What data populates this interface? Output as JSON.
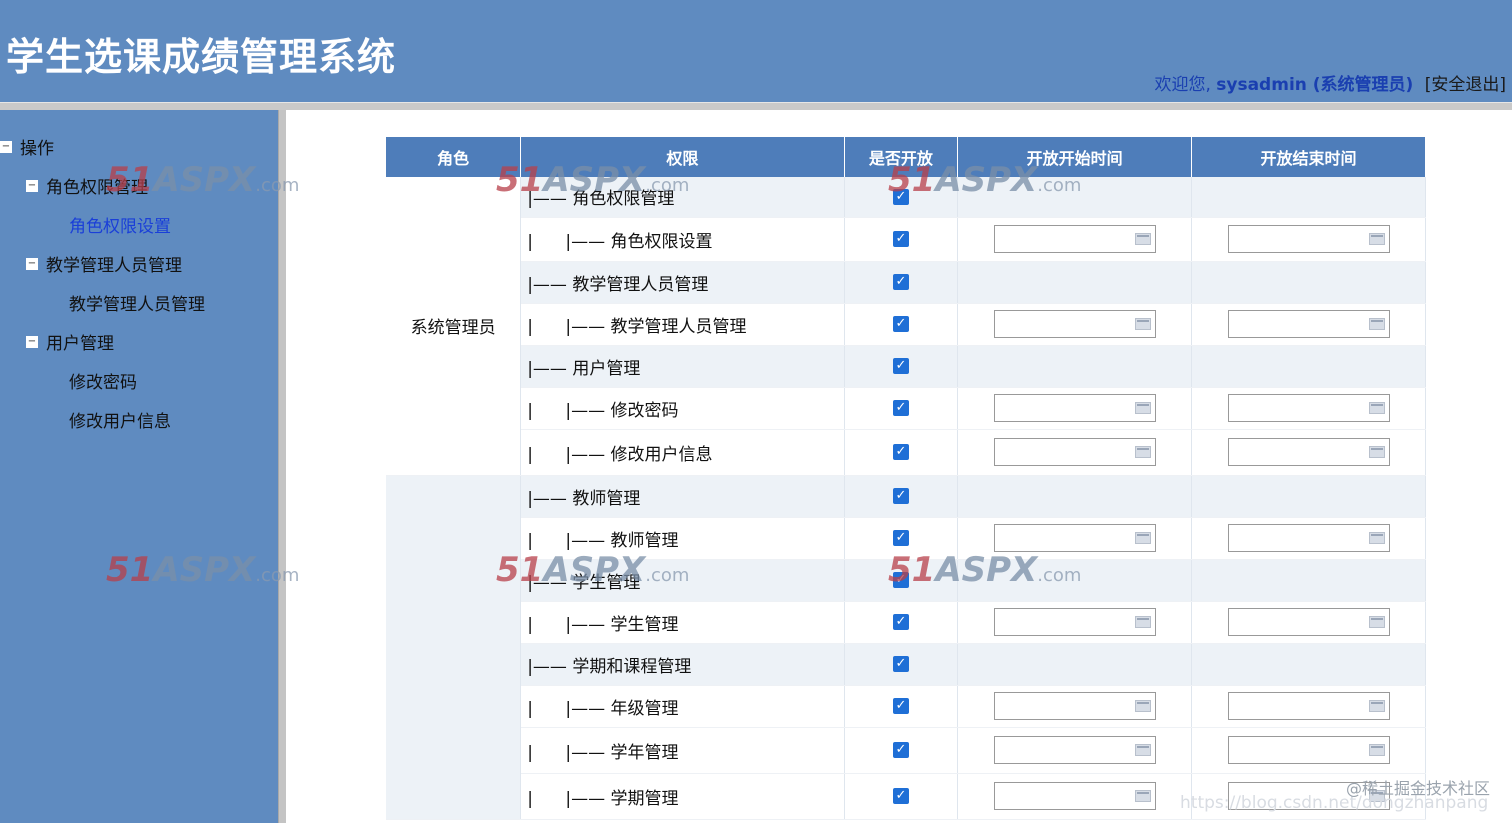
{
  "header": {
    "title": "学生选课成绩管理系统",
    "welcome": "欢迎您,",
    "username": "sysadmin (系统管理员)",
    "logout": "[安全退出]"
  },
  "sidebar": {
    "root": "操作",
    "groups": [
      {
        "label": "角色权限管理",
        "items": [
          "角色权限设置"
        ]
      },
      {
        "label": "教学管理人员管理",
        "items": [
          "教学管理人员管理"
        ]
      },
      {
        "label": "用户管理",
        "items": [
          "修改密码",
          "修改用户信息"
        ]
      }
    ]
  },
  "table": {
    "headers": [
      "角色",
      "权限",
      "是否开放",
      "开放开始时间",
      "开放结束时间"
    ],
    "role_label": "系统管理员",
    "rows": [
      {
        "indent": 1,
        "label": "角色权限管理"
      },
      {
        "indent": 2,
        "label": "角色权限设置"
      },
      {
        "indent": 1,
        "label": "教学管理人员管理"
      },
      {
        "indent": 2,
        "label": "教学管理人员管理"
      },
      {
        "indent": 1,
        "label": "用户管理"
      },
      {
        "indent": 2,
        "label": "修改密码"
      },
      {
        "indent": 2,
        "label": "修改用户信息"
      },
      {
        "indent": 1,
        "label": "教师管理"
      },
      {
        "indent": 2,
        "label": "教师管理"
      },
      {
        "indent": 1,
        "label": "学生管理"
      },
      {
        "indent": 2,
        "label": "学生管理"
      },
      {
        "indent": 1,
        "label": "学期和课程管理"
      },
      {
        "indent": 2,
        "label": "年级管理"
      },
      {
        "indent": 2,
        "label": "学年管理"
      },
      {
        "indent": 2,
        "label": "学期管理"
      }
    ]
  },
  "watermark": {
    "brand": "51",
    "brand2": "ASPX",
    "suffix": ".com"
  },
  "credit": "@稀土掘金技术社区",
  "faint_url": "https://blog.csdn.net/dongzhanpang"
}
